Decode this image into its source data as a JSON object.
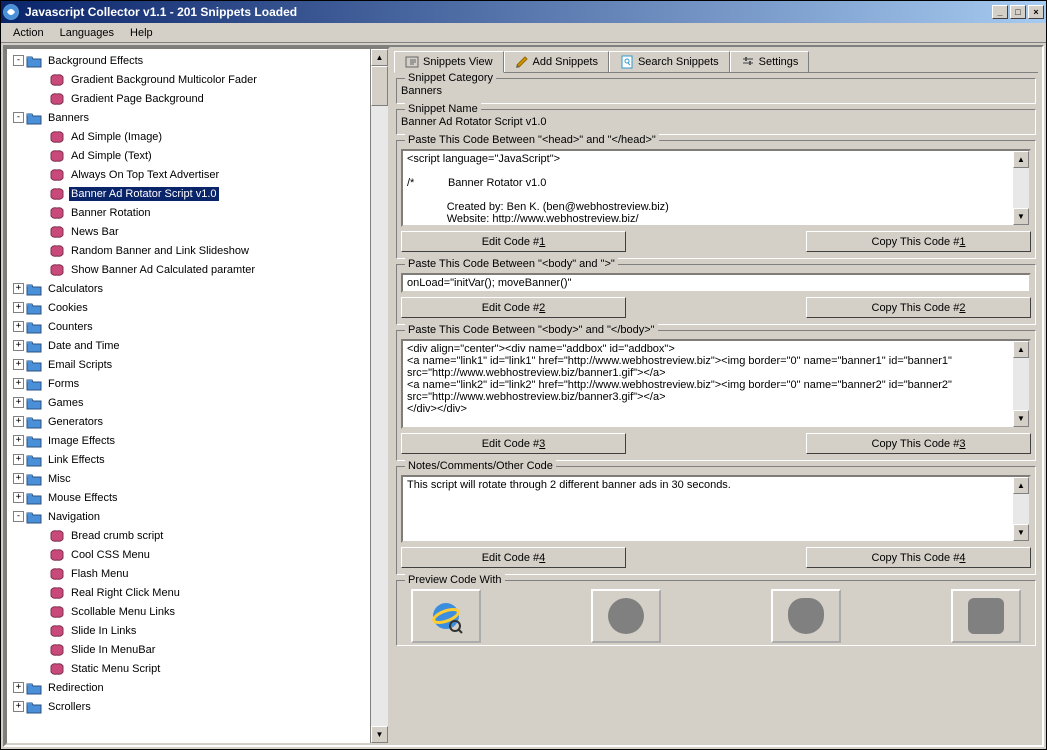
{
  "window": {
    "title": "Javascript Collector v1.1  -  201 Snippets Loaded"
  },
  "menu": {
    "action": "Action",
    "languages": "Languages",
    "help": "Help"
  },
  "tree": {
    "root_expanded": [
      {
        "type": "folder",
        "label": "Background Effects",
        "state": "-",
        "children": [
          {
            "type": "leaf",
            "label": "Gradient Background Multicolor Fader"
          },
          {
            "type": "leaf",
            "label": "Gradient Page  Background"
          }
        ]
      },
      {
        "type": "folder",
        "label": "Banners",
        "state": "-",
        "children": [
          {
            "type": "leaf",
            "label": "Ad Simple (Image)"
          },
          {
            "type": "leaf",
            "label": "Ad Simple (Text)"
          },
          {
            "type": "leaf",
            "label": "Always On Top Text Advertiser"
          },
          {
            "type": "leaf",
            "label": "Banner Ad Rotator Script v1.0",
            "selected": true
          },
          {
            "type": "leaf",
            "label": "Banner Rotation"
          },
          {
            "type": "leaf",
            "label": "News Bar"
          },
          {
            "type": "leaf",
            "label": "Random Banner and Link Slideshow"
          },
          {
            "type": "leaf",
            "label": "Show Banner Ad Calculated paramter"
          }
        ]
      },
      {
        "type": "folder",
        "label": "Calculators",
        "state": "+"
      },
      {
        "type": "folder",
        "label": "Cookies",
        "state": "+"
      },
      {
        "type": "folder",
        "label": "Counters",
        "state": "+"
      },
      {
        "type": "folder",
        "label": "Date and Time",
        "state": "+"
      },
      {
        "type": "folder",
        "label": "Email Scripts",
        "state": "+"
      },
      {
        "type": "folder",
        "label": "Forms",
        "state": "+"
      },
      {
        "type": "folder",
        "label": "Games",
        "state": "+"
      },
      {
        "type": "folder",
        "label": "Generators",
        "state": "+"
      },
      {
        "type": "folder",
        "label": "Image Effects",
        "state": "+"
      },
      {
        "type": "folder",
        "label": "Link Effects",
        "state": "+"
      },
      {
        "type": "folder",
        "label": "Misc",
        "state": "+"
      },
      {
        "type": "folder",
        "label": "Mouse Effects",
        "state": "+"
      },
      {
        "type": "folder",
        "label": "Navigation",
        "state": "-",
        "children": [
          {
            "type": "leaf",
            "label": "Bread crumb script"
          },
          {
            "type": "leaf",
            "label": "Cool  CSS Menu"
          },
          {
            "type": "leaf",
            "label": "Flash Menu"
          },
          {
            "type": "leaf",
            "label": "Real Right Click Menu"
          },
          {
            "type": "leaf",
            "label": "Scollable Menu Links"
          },
          {
            "type": "leaf",
            "label": "Slide In Links"
          },
          {
            "type": "leaf",
            "label": "Slide In MenuBar"
          },
          {
            "type": "leaf",
            "label": "Static Menu Script"
          }
        ]
      },
      {
        "type": "folder",
        "label": "Redirection",
        "state": "+"
      },
      {
        "type": "folder",
        "label": "Scrollers",
        "state": "+"
      }
    ]
  },
  "tabs": {
    "snippets_view": "Snippets View",
    "add_snippets": "Add Snippets",
    "search_snippets": "Search Snippets",
    "settings": "Settings"
  },
  "snippet": {
    "category_legend": "Snippet Category",
    "category_value": "Banners",
    "name_legend": "Snippet Name",
    "name_value": "Banner Ad Rotator Script v1.0",
    "code1_legend": "Paste This Code Between \"<head>\" and \"</head>\"",
    "code1_text": "<script language=\"JavaScript\">\n\n/*           Banner Rotator v1.0\n\n             Created by: Ben K. (ben@webhostreview.biz)\n             Website: http://www.webhostreview.biz/",
    "edit1": "Edit Code #1",
    "copy1": "Copy This Code #1",
    "code2_legend": "Paste This Code Between \"<body\" and \">\"",
    "code2_text": "onLoad=\"initVar(); moveBanner()\"",
    "edit2": "Edit Code #2",
    "copy2": "Copy This Code #2",
    "code3_legend": "Paste This Code Between \"<body>\" and \"</body>\"",
    "code3_text": "<div align=\"center\"><div name=\"addbox\" id=\"addbox\">\n<a name=\"link1\" id=\"link1\" href=\"http://www.webhostreview.biz\"><img border=\"0\" name=\"banner1\" id=\"banner1\" src=\"http://www.webhostreview.biz/banner1.gif\"></a>\n<a name=\"link2\" id=\"link2\" href=\"http://www.webhostreview.biz\"><img border=\"0\" name=\"banner2\" id=\"banner2\" src=\"http://www.webhostreview.biz/banner3.gif\"></a>\n</div></div>",
    "edit3": "Edit Code #3",
    "copy3": "Copy This Code #3",
    "notes_legend": "Notes/Comments/Other Code",
    "notes_text": "This script will rotate through 2 different banner ads in 30 seconds.",
    "edit4": "Edit Code #4",
    "copy4": "Copy This Code #4",
    "preview_legend": "Preview Code With"
  }
}
